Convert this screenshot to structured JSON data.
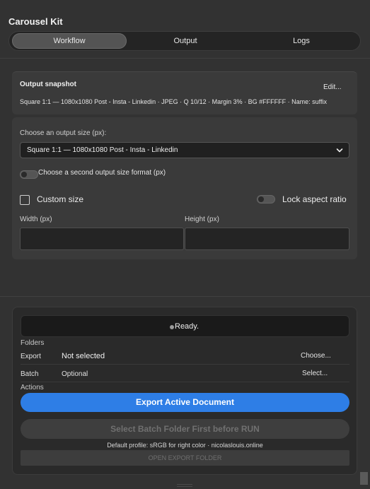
{
  "app": {
    "title": "Carousel Kit"
  },
  "tabs": [
    {
      "label": "Workflow",
      "active": true
    },
    {
      "label": "Output",
      "active": false
    },
    {
      "label": "Logs",
      "active": false
    }
  ],
  "snapshot": {
    "title": "Output snapshot",
    "edit_label": "Edit...",
    "summary": "Square 1:1 — 1080x1080 Post - Insta - Linkedin · JPEG · Q 10/12 · Margin 3% · BG #FFFFFF · Name: suffix"
  },
  "output_size": {
    "label": "Choose an output size (px):",
    "selected": "Square 1:1 — 1080x1080 Post - Insta - Linkedin",
    "second_format_label": "Choose a second output size format (px)",
    "custom_size_label": "Custom size",
    "lock_aspect_label": "Lock aspect ratio",
    "width_label": "Width (px)",
    "height_label": "Height (px)",
    "width_value": "",
    "height_value": ""
  },
  "status": {
    "text": "Ready."
  },
  "folders": {
    "section_label": "Folders",
    "export": {
      "key": "Export",
      "value": "Not selected",
      "action": "Choose..."
    },
    "batch": {
      "key": "Batch",
      "value": "Optional",
      "action": "Select..."
    }
  },
  "actions": {
    "section_label": "Actions",
    "export_active": "Export Active Document",
    "batch_run": "Select Batch Folder First before RUN",
    "footnote": "Default profile: sRGB for right color · nicolaslouis.online",
    "open_folder": "OPEN EXPORT FOLDER"
  },
  "colors": {
    "accent": "#2e7ee6",
    "background": "#323232",
    "panel": "#3a3a3a"
  },
  "icons": {
    "dropdown": "chevron-down-icon",
    "status": "status-dot-icon"
  }
}
